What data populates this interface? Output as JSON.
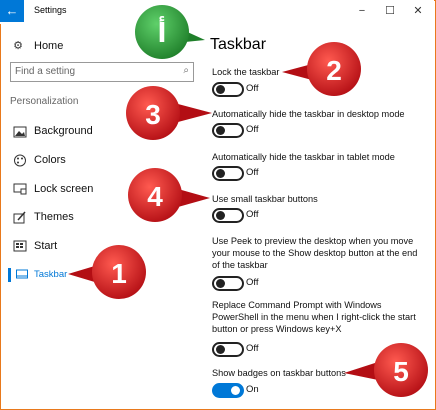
{
  "window": {
    "title": "Settings",
    "back_glyph": "←",
    "minimize_glyph": "−",
    "maximize_glyph": "☐",
    "close_glyph": "✕"
  },
  "sidebar": {
    "home_label": "Home",
    "search_placeholder": "Find a setting",
    "section_label": "Personalization",
    "items": [
      {
        "label": "Background",
        "icon": "image-icon"
      },
      {
        "label": "Colors",
        "icon": "palette-icon"
      },
      {
        "label": "Lock screen",
        "icon": "lock-screen-icon"
      },
      {
        "label": "Themes",
        "icon": "themes-icon"
      },
      {
        "label": "Start",
        "icon": "start-icon"
      },
      {
        "label": "Taskbar",
        "icon": "taskbar-icon",
        "selected": true
      }
    ]
  },
  "main": {
    "title": "Taskbar",
    "settings": [
      {
        "label": "Lock the taskbar",
        "state": "Off"
      },
      {
        "label": "Automatically hide the taskbar in desktop mode",
        "state": "Off"
      },
      {
        "label": "Automatically hide the taskbar in tablet mode",
        "state": "Off"
      },
      {
        "label": "Use small taskbar buttons",
        "state": "Off"
      },
      {
        "label": "Use Peek to preview the desktop when you move your mouse to the Show desktop button at the end of the taskbar",
        "state": "Off"
      },
      {
        "label": "Replace Command Prompt with Windows PowerShell in the menu when I right-click the start button or press Windows key+X",
        "state": "Off"
      },
      {
        "label": "Show badges on taskbar buttons",
        "state": "On"
      }
    ]
  },
  "callouts": {
    "green_label": "أ",
    "numbers": [
      "1",
      "2",
      "3",
      "4",
      "5"
    ],
    "green_color": "#2e9a3a",
    "red_color": "#c9161b"
  },
  "colors": {
    "accent": "#0078d7",
    "frame": "#e8791c"
  }
}
